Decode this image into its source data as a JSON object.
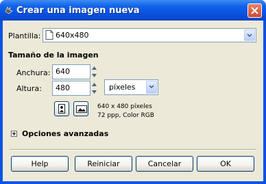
{
  "window": {
    "title": "Crear una imagen nueva"
  },
  "template": {
    "label": "Plantilla:",
    "value": "640x480"
  },
  "image_size": {
    "heading": "Tamaño de la imagen",
    "width_label": "Anchura:",
    "width_value": "640",
    "height_label": "Altura:",
    "height_value": "480",
    "unit": "píxeles",
    "info_line1": "640 x 480 píxeles",
    "info_line2": "72 ppp, Color RGB"
  },
  "advanced": {
    "label": "Opciones avanzadas"
  },
  "buttons": {
    "help": "Help",
    "reset": "Reiniciar",
    "cancel": "Cancelar",
    "ok": "OK"
  },
  "icons": [
    "gimp-wilber-icon",
    "close-icon",
    "template-icon",
    "chevron-down-icon",
    "portrait-icon",
    "landscape-icon",
    "expand-icon"
  ]
}
